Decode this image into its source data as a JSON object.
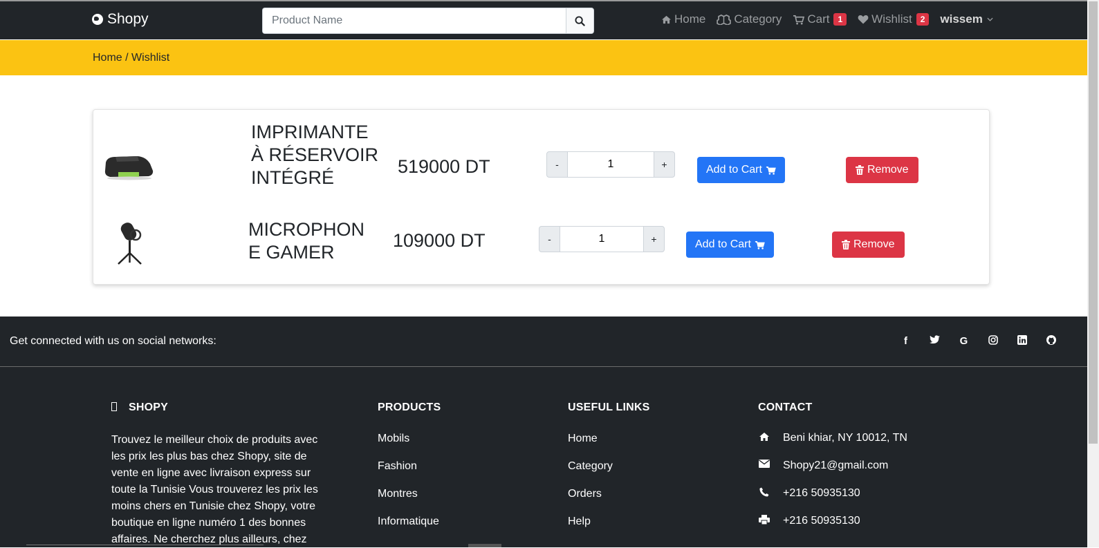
{
  "navbar": {
    "brand": "Shopy",
    "search_placeholder": "Product Name",
    "links": [
      {
        "label": "Home",
        "icon": "home-icon"
      },
      {
        "label": "Category",
        "icon": "cubes-icon"
      },
      {
        "label": "Cart",
        "icon": "cart-icon",
        "badge": "1"
      },
      {
        "label": "Wishlist",
        "icon": "heart-icon",
        "badge": "2"
      }
    ],
    "user": "wissem"
  },
  "breadcrumb": {
    "home": "Home",
    "separator": " / ",
    "current": "Wishlist"
  },
  "wishlist": {
    "items": [
      {
        "name": "IMPRIMANTE À RÉSERVOIR INTÉGRÉ",
        "price": "519000 DT",
        "qty": "1",
        "image": "printer-image"
      },
      {
        "name": "MICROPHONE GAMER",
        "price": "109000 DT",
        "qty": "1",
        "image": "microphone-image"
      }
    ],
    "minus_label": "-",
    "plus_label": "+",
    "add_to_cart_label": "Add to Cart",
    "remove_label": "Remove"
  },
  "footer": {
    "social_text": "Get connected with us on social networks:",
    "social_icons": [
      "facebook-icon",
      "twitter-icon",
      "google-icon",
      "instagram-icon",
      "linkedin-icon",
      "github-icon"
    ],
    "brand_heading": "SHOPY",
    "brand_text": "Trouvez le meilleur choix de produits avec les prix les plus bas chez Shopy, site de vente en ligne avec livraison express sur toute la Tunisie Vous trouverez les prix les moins chers en Tunisie chez Shopy, votre boutique en ligne numéro 1 des bonnes affaires. Ne cherchez plus ailleurs, chez",
    "products_heading": "PRODUCTS",
    "products": [
      "Mobils",
      "Fashion",
      "Montres",
      "Informatique"
    ],
    "useful_heading": "USEFUL LINKS",
    "useful_links": [
      "Home",
      "Category",
      "Orders",
      "Help"
    ],
    "contact_heading": "CONTACT",
    "contact": [
      {
        "icon": "home-icon",
        "text": "Beni khiar, NY 10012, TN"
      },
      {
        "icon": "envelope-icon",
        "text": "Shopy21@gmail.com"
      },
      {
        "icon": "phone-icon",
        "text": "+216 50935130"
      },
      {
        "icon": "print-icon",
        "text": "+216 50935130"
      }
    ]
  },
  "colors": {
    "navbar": "#212529",
    "breadcrumb_bar": "#fbc312",
    "primary": "#2375f6",
    "danger": "#dc3545"
  }
}
